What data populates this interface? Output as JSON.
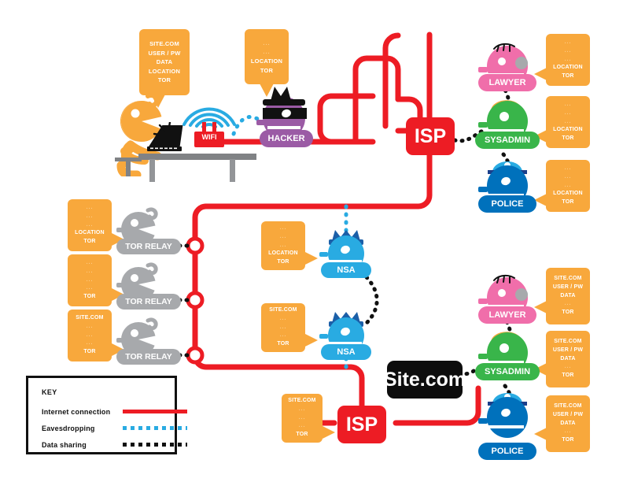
{
  "diagram": {
    "title": "Tor network privacy data-flow diagram"
  },
  "callouts": {
    "user": {
      "lines": [
        "SITE.COM",
        "USER / PW",
        "DATA",
        "LOCATION",
        "TOR"
      ],
      "dim": [
        false,
        false,
        false,
        false,
        false
      ]
    },
    "hacker": {
      "lines": [
        "...",
        "...",
        "LOCATION",
        "TOR"
      ],
      "dim": [
        true,
        true,
        false,
        false
      ]
    },
    "lawyer_top": {
      "lines": [
        "...",
        "...",
        "...",
        "LOCATION",
        "TOR"
      ],
      "dim": [
        true,
        true,
        true,
        false,
        false
      ]
    },
    "sysadmin_top": {
      "lines": [
        "...",
        "...",
        "...",
        "LOCATION",
        "TOR"
      ],
      "dim": [
        true,
        true,
        true,
        false,
        false
      ]
    },
    "police_top": {
      "lines": [
        "...",
        "...",
        "...",
        "LOCATION",
        "TOR"
      ],
      "dim": [
        true,
        true,
        true,
        false,
        false
      ]
    },
    "relay1": {
      "lines": [
        "...",
        "...",
        "...",
        "LOCATION",
        "TOR"
      ],
      "dim": [
        true,
        true,
        true,
        false,
        false
      ]
    },
    "relay2": {
      "lines": [
        "...",
        "...",
        "...",
        "...",
        "TOR"
      ],
      "dim": [
        true,
        true,
        true,
        true,
        false
      ]
    },
    "relay3": {
      "lines": [
        "SITE.COM",
        "...",
        "...",
        "...",
        "TOR"
      ],
      "dim": [
        false,
        true,
        true,
        true,
        false
      ]
    },
    "nsa1": {
      "lines": [
        "...",
        "...",
        "...",
        "LOCATION",
        "TOR"
      ],
      "dim": [
        true,
        true,
        true,
        false,
        false
      ]
    },
    "nsa2": {
      "lines": [
        "SITE.COM",
        "...",
        "...",
        "...",
        "TOR"
      ],
      "dim": [
        false,
        true,
        true,
        true,
        false
      ]
    },
    "isp_bottom": {
      "lines": [
        "SITE.COM",
        "...",
        "...",
        "...",
        "TOR"
      ],
      "dim": [
        false,
        true,
        true,
        true,
        false
      ]
    },
    "lawyer_bottom": {
      "lines": [
        "SITE.COM",
        "USER / PW",
        "DATA",
        "...",
        "TOR"
      ],
      "dim": [
        false,
        false,
        false,
        true,
        false
      ]
    },
    "sysadmin_bottom": {
      "lines": [
        "SITE.COM",
        "USER / PW",
        "DATA",
        "...",
        "TOR"
      ],
      "dim": [
        false,
        false,
        false,
        true,
        false
      ]
    },
    "police_bottom": {
      "lines": [
        "SITE.COM",
        "USER / PW",
        "DATA",
        "...",
        "TOR"
      ],
      "dim": [
        false,
        false,
        false,
        true,
        false
      ]
    }
  },
  "labels": {
    "wifi": "WIFI",
    "hacker": "HACKER",
    "isp_top": "ISP",
    "isp_bottom": "ISP",
    "site": "Site.com",
    "tor_relay_1": "TOR RELAY",
    "tor_relay_2": "TOR RELAY",
    "tor_relay_3": "TOR RELAY",
    "nsa_1": "NSA",
    "nsa_2": "NSA",
    "lawyer_top": "LAWYER",
    "sysadmin_top": "SYSADMIN",
    "police_top": "POLICE",
    "lawyer_bottom": "LAWYER",
    "sysadmin_bottom": "SYSADMIN",
    "police_bottom": "POLICE"
  },
  "legend": {
    "title": "KEY",
    "rows": [
      {
        "label": "Internet connection",
        "style": "solid",
        "color": "#ED1C24"
      },
      {
        "label": "Eavesdropping",
        "style": "dotted",
        "color": "#29ABE2"
      },
      {
        "label": "Data sharing",
        "style": "dotted",
        "color": "#111111"
      }
    ]
  },
  "colors": {
    "internet_red": "#ED1C24",
    "eavesdrop_blue": "#29ABE2",
    "data_black": "#111111",
    "callout_orange": "#F8A83C",
    "user_orange": "#F8A83C",
    "hacker_purple": "#9B5BA5",
    "relay_gray": "#A7A9AC",
    "nsa_blue": "#29ABE2",
    "lawyer_pink": "#F06EAA",
    "sysadmin_green": "#39B54A",
    "police_blue": "#0071BC",
    "desk_gray": "#808285"
  }
}
